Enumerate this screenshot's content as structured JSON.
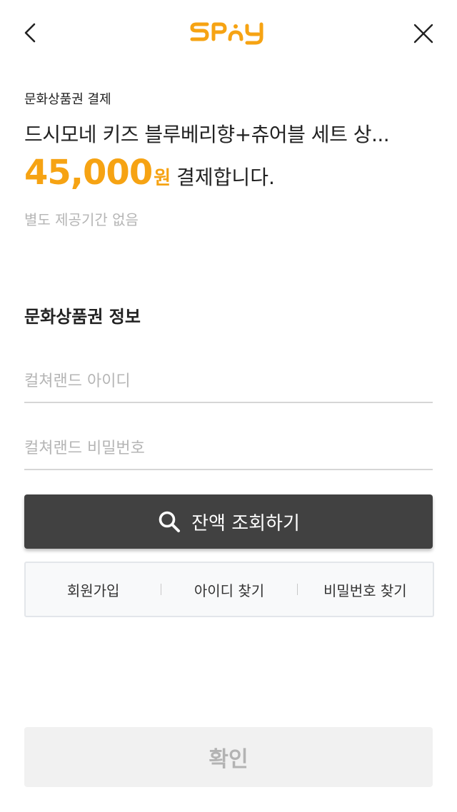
{
  "header": {
    "logo_text": "SPAY",
    "back_icon": "chevron-left-icon",
    "close_icon": "close-icon"
  },
  "payment": {
    "label": "문화상품권 결제",
    "product_title": "드시모네 키즈 블루베리향+츄어블 세트 상...",
    "amount": "45,000",
    "currency_unit": "원",
    "amount_suffix": "결제합니다.",
    "notice": "별도 제공기간 없음"
  },
  "voucher": {
    "section_title": "문화상품권 정보",
    "id_placeholder": "컬쳐랜드 아이디",
    "id_value": "",
    "password_placeholder": "컬쳐랜드 비밀번호",
    "password_value": ""
  },
  "balance_button": {
    "label": "잔액 조회하기",
    "icon": "search-icon"
  },
  "links": {
    "signup": "회원가입",
    "find_id": "아이디 찾기",
    "find_password": "비밀번호 찾기"
  },
  "confirm_button": {
    "label": "확인",
    "state": "disabled"
  },
  "colors": {
    "accent": "#f6a313",
    "dark_button": "#414141",
    "placeholder": "#b5b5b5",
    "disabled_bg": "#f1f1f1"
  }
}
